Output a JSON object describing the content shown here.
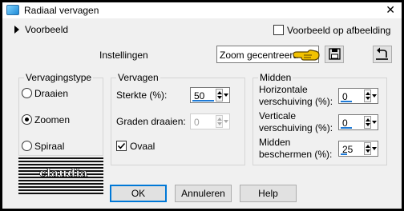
{
  "window": {
    "title": "Radiaal vervagen"
  },
  "preview": {
    "label": "Voorbeeld",
    "on_image_label": "Voorbeeld op afbeelding"
  },
  "settings": {
    "label": "Instellingen",
    "preset_value": "Zoom gecentreerd"
  },
  "blur_type": {
    "title": "Vervagingstype",
    "options": [
      "Draaien",
      "Zoomen",
      "Spiraal"
    ],
    "selected": "Zoomen"
  },
  "blur": {
    "title": "Vervagen",
    "strength_label": "Sterkte (%):",
    "strength_value": "50",
    "twist_label": "Graden draaien:",
    "twist_value": "0",
    "oval_label": "Ovaal",
    "oval_checked": true
  },
  "center": {
    "title": "Midden",
    "h_label_1": "Horizontale",
    "h_label_2": "verschuiving (%):",
    "h_value": "0",
    "v_label_1": "Verticale",
    "v_label_2": "verschuiving (%):",
    "v_value": "0",
    "protect_label_1": "Midden",
    "protect_label_2": "beschermen (%):",
    "protect_value": "25"
  },
  "buttons": {
    "ok": "OK",
    "cancel": "Annuleren",
    "help": "Help"
  },
  "watermark": {
    "text": "claudia"
  },
  "colors": {
    "accent": "#0078d7",
    "pointer_hand": "#f2c200"
  }
}
